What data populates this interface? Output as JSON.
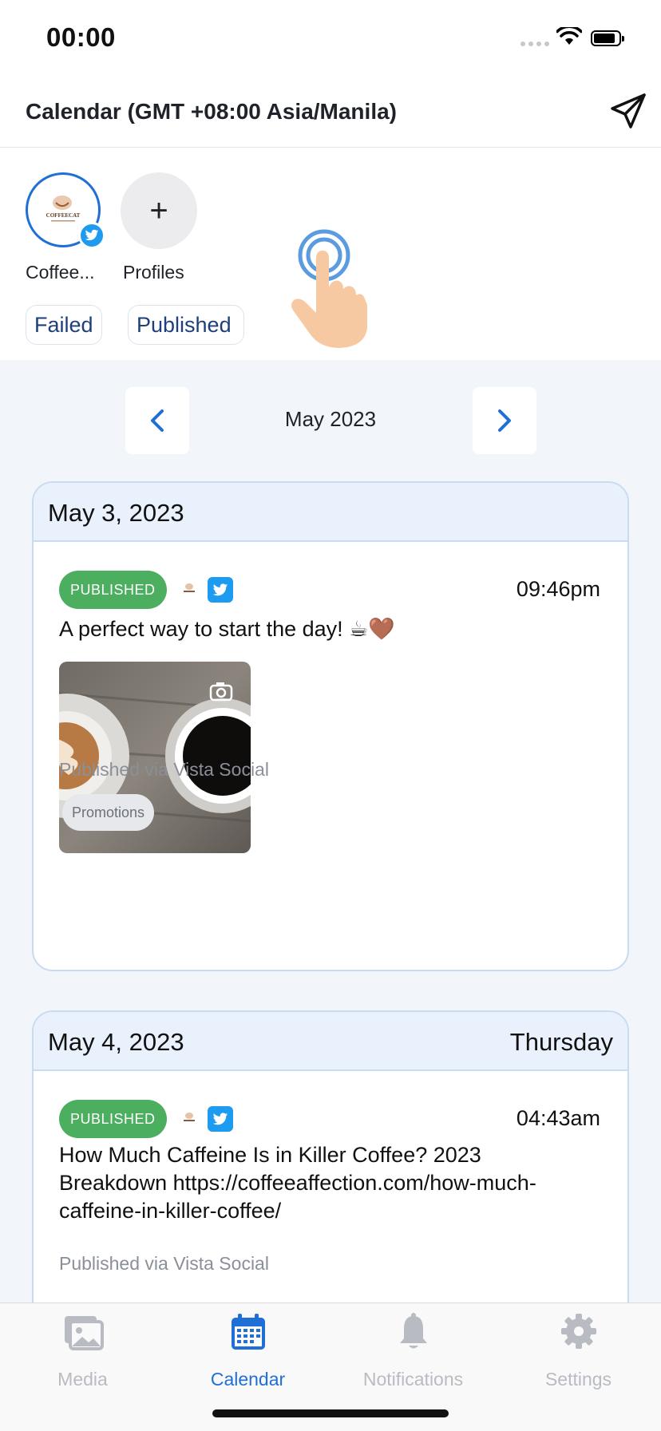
{
  "status_bar": {
    "time": "00:00"
  },
  "header": {
    "title": "Calendar (GMT +08:00 Asia/Manila)"
  },
  "profiles": {
    "items": [
      {
        "label": "Coffee...",
        "network": "twitter"
      },
      {
        "label": "Profiles",
        "icon": "plus-icon"
      }
    ],
    "avatar_logo_text": "COFFEECAT"
  },
  "filters": {
    "failed": "Failed",
    "published": "Published"
  },
  "month_nav": {
    "label": "May 2023"
  },
  "days": [
    {
      "date": "May 3, 2023",
      "day": "",
      "post": {
        "status": "PUBLISHED",
        "time": "09:46pm",
        "text": "A perfect way to start the day! ☕🤎",
        "via": "Published via Vista Social",
        "tag": "Promotions"
      }
    },
    {
      "date": "May 4, 2023",
      "day": "Thursday",
      "post": {
        "status": "PUBLISHED",
        "time": "04:43am",
        "text": "How Much Caffeine Is in Killer Coffee? 2023 Breakdown https://coffeeaffection.com/how-much-caffeine-in-killer-coffee/",
        "via": "Published via Vista Social"
      }
    }
  ],
  "tabs": [
    {
      "label": "Media",
      "icon": "media-icon"
    },
    {
      "label": "Calendar",
      "icon": "calendar-icon",
      "active": true
    },
    {
      "label": "Notifications",
      "icon": "bell-icon"
    },
    {
      "label": "Settings",
      "icon": "gear-icon"
    }
  ],
  "colors": {
    "accent": "#1f6fd6",
    "published_badge": "#4cae5f",
    "twitter": "#1d9bf0",
    "inactive_tab": "#b8bcc2"
  }
}
